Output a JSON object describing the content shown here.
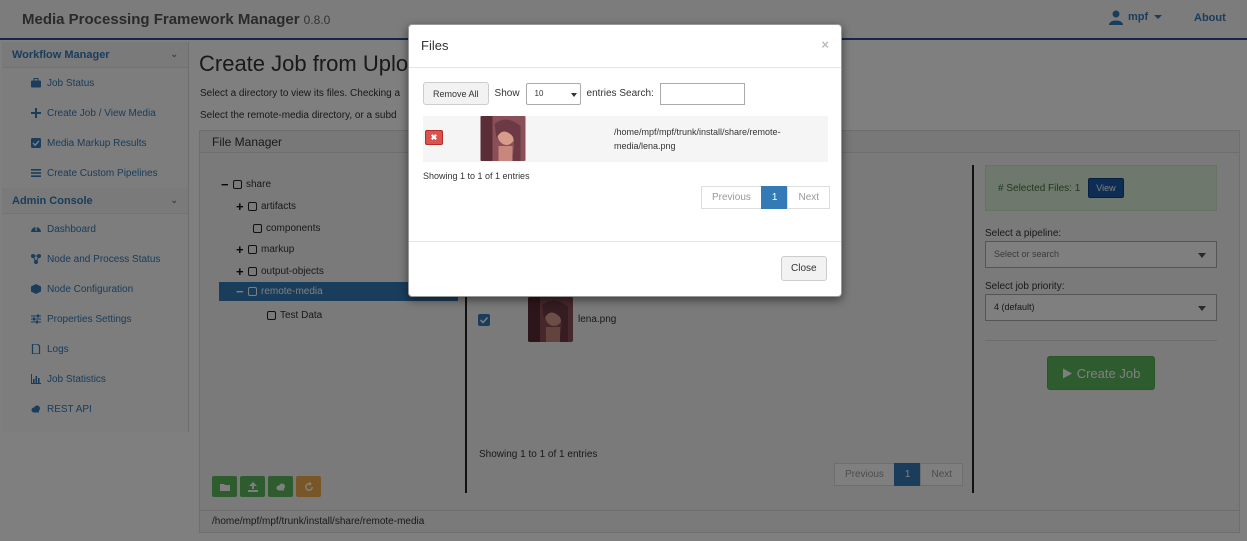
{
  "navbar": {
    "brand": "Media Processing Framework Manager",
    "version": "0.8.0",
    "user": "mpf",
    "about": "About"
  },
  "sidebar": {
    "workflow_title": "Workflow Manager",
    "workflow_items": [
      {
        "label": "Job Status",
        "icon": "briefcase-icon"
      },
      {
        "label": "Create Job / View Media",
        "icon": "plus-icon"
      },
      {
        "label": "Media Markup Results",
        "icon": "check-square-icon"
      },
      {
        "label": "Create Custom Pipelines",
        "icon": "list-icon"
      }
    ],
    "admin_title": "Admin Console",
    "admin_items": [
      {
        "label": "Dashboard",
        "icon": "dashboard-icon"
      },
      {
        "label": "Node and Process Status",
        "icon": "nodes-icon"
      },
      {
        "label": "Node Configuration",
        "icon": "cube-icon"
      },
      {
        "label": "Properties Settings",
        "icon": "sliders-icon"
      },
      {
        "label": "Logs",
        "icon": "file-icon"
      },
      {
        "label": "Job Statistics",
        "icon": "bar-chart-icon"
      },
      {
        "label": "REST API",
        "icon": "cloud-icon"
      }
    ]
  },
  "main": {
    "title": "Create Job from Uplo",
    "desc1": "Select a directory to view its files. Checking a",
    "desc2": "Select the remote-media directory, or a subd",
    "file_manager_title": "File Manager",
    "tree": [
      {
        "label": "share",
        "prefix": "−",
        "selected": false
      },
      {
        "label": "artifacts",
        "prefix": "+",
        "selected": false
      },
      {
        "label": "components",
        "prefix": "",
        "selected": false
      },
      {
        "label": "markup",
        "prefix": "+",
        "selected": false
      },
      {
        "label": "output-objects",
        "prefix": "+",
        "selected": false
      },
      {
        "label": "remote-media",
        "prefix": "−",
        "selected": true
      },
      {
        "label": "Test Data",
        "prefix": "",
        "selected": false
      }
    ],
    "current_path": "/home/mpf/mpf/trunk/install/share/remote-media",
    "file_list_item": "lena.png",
    "file_list_showing": "Showing 1 to 1 of 1 entries",
    "pager": {
      "previous": "Previous",
      "page": "1",
      "next": "Next"
    },
    "selected_files": "# Selected Files: 1",
    "view_label": "View",
    "pipeline_label": "Select a pipeline:",
    "pipeline_placeholder": "Select or search",
    "priority_label": "Select job priority:",
    "priority_value": "4 (default)",
    "create_job": "Create Job",
    "colors": {
      "primary": "#337ab7",
      "success": "#5cb85c",
      "warning": "#f0ad4e",
      "danger": "#d9534f"
    }
  },
  "modal": {
    "title": "Files",
    "close_x": "×",
    "remove_all": "Remove All",
    "show": "Show",
    "show_value": "10",
    "entries_search": "entries Search:",
    "file_path": "/home/mpf/mpf/trunk/install/share/remote-media/lena.png",
    "showing": "Showing 1 to 1 of 1 entries",
    "pager": {
      "previous": "Previous",
      "page": "1",
      "next": "Next"
    },
    "close": "Close"
  }
}
